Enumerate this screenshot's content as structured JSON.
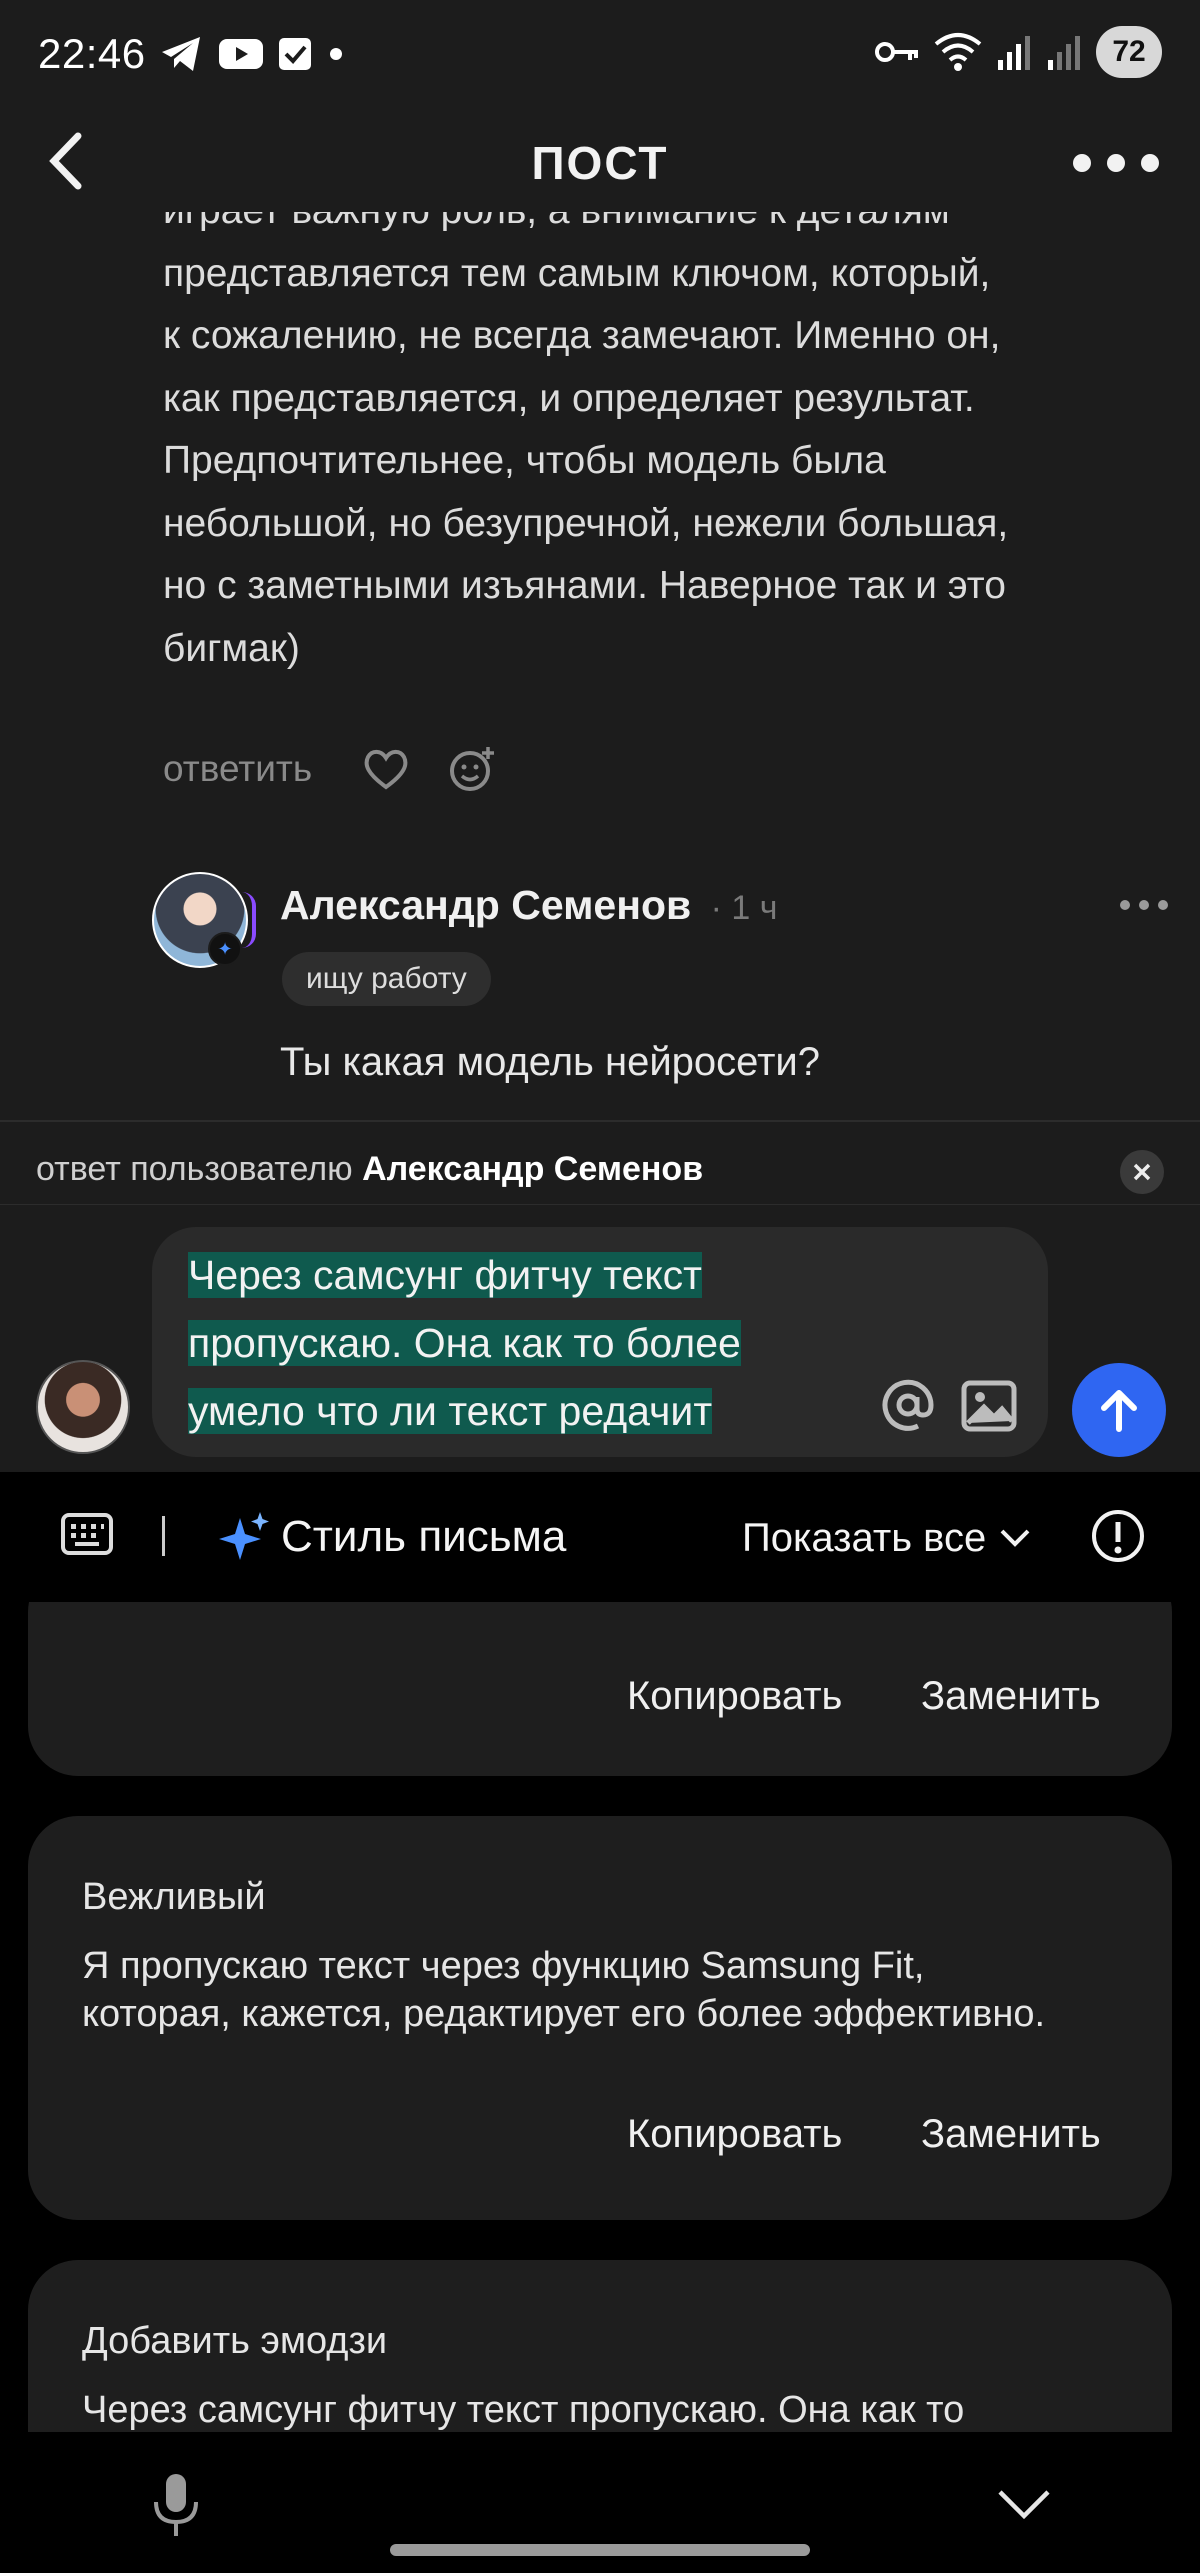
{
  "status_bar": {
    "time": "22:46",
    "battery": "72"
  },
  "header": {
    "title": "ПОСТ"
  },
  "comment": {
    "lines": [
      "играет важную роль, а внимание к деталям",
      "представляется тем самым ключом, который,",
      "к сожалению, не всегда замечают. Именно он,",
      "как представляется, и определяет результат.",
      "Предпочтительнее, чтобы модель была",
      "небольшой, но безупречной, нежели большая,",
      "но с заметными изъянами. Наверное так и это",
      "бигмак)"
    ],
    "reply_label": "ответить"
  },
  "reply_comment": {
    "author": "Александр Семенов",
    "time": "· 1 ч",
    "status_chip": "ищу работу",
    "text": "Ты какая модель нейросети?"
  },
  "reply_to": {
    "prefix": "ответ пользователю",
    "name": "Александр Семенов"
  },
  "composer": {
    "lines": [
      "Через самсунг фитчу текст",
      "пропускаю. Она как то более",
      "умело что ли текст редачит"
    ]
  },
  "keyboard": {
    "style_title": "Стиль письма",
    "show_all": "Показать все"
  },
  "suggestions": [
    {
      "title": "",
      "text": "",
      "copy": "Копировать",
      "replace": "Заменить"
    },
    {
      "title": "Вежливый",
      "text_lines": [
        "Я пропускаю текст через функцию Samsung Fit,",
        "которая, кажется, редактирует его более эффективно."
      ],
      "copy": "Копировать",
      "replace": "Заменить"
    },
    {
      "title": "Добавить эмодзи",
      "text_lines": [
        "Через самсунг фитчу текст пропускаю. Она как то"
      ]
    }
  ],
  "colors": {
    "accent": "#2f66f2",
    "highlight": "#0f5a4e",
    "app_bg": "#1c1c1c",
    "keyboard_bg": "#000000"
  }
}
